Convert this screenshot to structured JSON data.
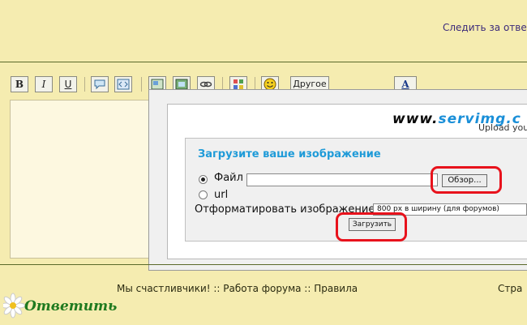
{
  "header": {
    "follow_link": "Следить за отве"
  },
  "toolbar": {
    "bold": "B",
    "italic": "I",
    "underline": "U",
    "other": "Другое",
    "font": "A"
  },
  "dialog": {
    "brand_prefix": "www.",
    "brand_accent": "servimg.c",
    "brand_tagline": "Upload you",
    "title": "Загрузите ваше изображение",
    "file_label": "Файл",
    "url_label": "url",
    "file_value": "",
    "browse_label": "Обзор...",
    "format_label": "Отформатировать изображение",
    "format_value": "800 px в ширину (для форумов)",
    "upload_label": "Загрузить",
    "selected_source": "file"
  },
  "footer": {
    "links": "Мы счастливчики! :: Работа форума :: Правила",
    "right": "Стра",
    "reply": "Ответить"
  },
  "colors": {
    "background": "#f5ecb0",
    "title": "#1f9bd8",
    "highlight": "#e8121c",
    "reply": "#1f7a1f"
  }
}
